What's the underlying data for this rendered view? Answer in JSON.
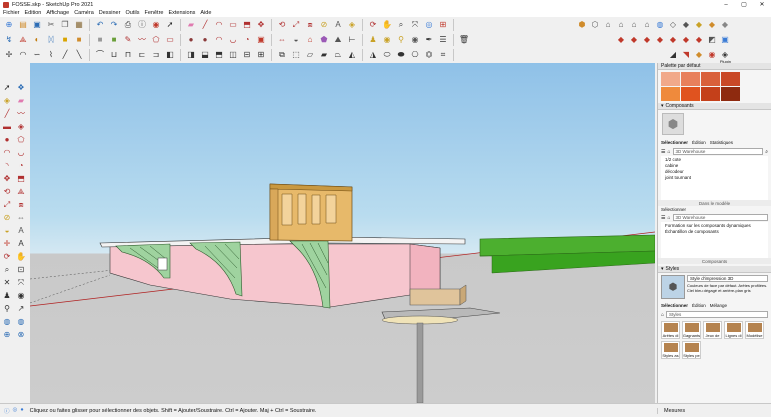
{
  "window": {
    "title": "FOSSE.skp - SketchUp Pro 2021"
  },
  "menu": [
    "Fichier",
    "Edition",
    "Affichage",
    "Caméra",
    "Dessiner",
    "Outils",
    "Fenêtre",
    "Extensions",
    "Aide"
  ],
  "toolbar1": [
    {
      "icon": "new-file-icon",
      "glyph": "⊕",
      "color": "#3a7bd5"
    },
    {
      "icon": "open-icon",
      "glyph": "▤",
      "color": "#d08c2c"
    },
    {
      "icon": "save-icon",
      "glyph": "▣",
      "color": "#2d6db5"
    },
    {
      "icon": "cut-icon",
      "glyph": "✂",
      "color": "#555"
    },
    {
      "icon": "copy-icon",
      "glyph": "❐",
      "color": "#555"
    },
    {
      "icon": "paste-icon",
      "glyph": "▦",
      "color": "#8a6d3b"
    },
    {
      "icon": "undo-icon",
      "glyph": "↶",
      "color": "#2d6db5"
    },
    {
      "icon": "redo-icon",
      "glyph": "↷",
      "color": "#2d6db5"
    },
    {
      "icon": "print-icon",
      "glyph": "⎙",
      "color": "#444"
    },
    {
      "icon": "model-info-icon",
      "glyph": "ⓘ",
      "color": "#555"
    },
    {
      "icon": "warehouse-icon",
      "glyph": "◉",
      "color": "#c0392b"
    },
    {
      "icon": "select-icon",
      "glyph": "➚",
      "color": "#222"
    },
    {
      "icon": "eraser-icon",
      "glyph": "▰",
      "color": "#e07bb0"
    },
    {
      "icon": "line-icon",
      "glyph": "╱",
      "color": "#b03030"
    },
    {
      "icon": "arc-icon",
      "glyph": "◠",
      "color": "#b03030"
    },
    {
      "icon": "shape-icon",
      "glyph": "▭",
      "color": "#b03030"
    },
    {
      "icon": "push-pull-icon",
      "glyph": "⬒",
      "color": "#b03030"
    },
    {
      "icon": "move-icon",
      "glyph": "✥",
      "color": "#b03030"
    },
    {
      "icon": "rotate-icon",
      "glyph": "⟲",
      "color": "#b03030"
    },
    {
      "icon": "scale-icon",
      "glyph": "⤢",
      "color": "#b03030"
    },
    {
      "icon": "offset-icon",
      "glyph": "⧈",
      "color": "#b03030"
    },
    {
      "icon": "tape-icon",
      "glyph": "⊘",
      "color": "#c9a227"
    },
    {
      "icon": "text-icon",
      "glyph": "A",
      "color": "#555"
    },
    {
      "icon": "paint-icon",
      "glyph": "◈",
      "color": "#c9a227"
    },
    {
      "icon": "orbit-icon",
      "glyph": "⟳",
      "color": "#b03030"
    },
    {
      "icon": "pan-icon",
      "glyph": "✋",
      "color": "#b03030"
    },
    {
      "icon": "zoom-icon",
      "glyph": "⌕",
      "color": "#333"
    },
    {
      "icon": "zoom-extents-icon",
      "glyph": "⤧",
      "color": "#333"
    },
    {
      "icon": "share-model-icon",
      "glyph": "◎",
      "color": "#3a7bd5"
    },
    {
      "icon": "extension-icon",
      "glyph": "⊞",
      "color": "#c0392b"
    }
  ],
  "toolbar1_right": [
    {
      "icon": "iso-view-icon",
      "glyph": "⬢",
      "color": "#d08c2c"
    },
    {
      "icon": "top-view-icon",
      "glyph": "⬡",
      "color": "#555"
    },
    {
      "icon": "front-view-icon",
      "glyph": "⌂",
      "color": "#555"
    },
    {
      "icon": "right-view-icon",
      "glyph": "⌂",
      "color": "#555"
    },
    {
      "icon": "back-view-icon",
      "glyph": "⌂",
      "color": "#555"
    },
    {
      "icon": "left-view-icon",
      "glyph": "⌂",
      "color": "#555"
    },
    {
      "icon": "xray-icon",
      "glyph": "◍",
      "color": "#3a7bd5"
    },
    {
      "icon": "wireframe-icon",
      "glyph": "◇",
      "color": "#555"
    },
    {
      "icon": "hidden-line-icon",
      "glyph": "◆",
      "color": "#555"
    },
    {
      "icon": "shaded-icon",
      "glyph": "◆",
      "color": "#c9a227"
    },
    {
      "icon": "textured-icon",
      "glyph": "◆",
      "color": "#d08c2c"
    },
    {
      "icon": "monochrome-icon",
      "glyph": "◆",
      "color": "#888"
    }
  ],
  "toolbar2": [
    {
      "icon": "axes-icon",
      "glyph": "↯",
      "color": "#2d6db5"
    },
    {
      "icon": "follow-me-icon",
      "glyph": "⟁",
      "color": "#c0392b"
    },
    {
      "icon": "section-plane-icon",
      "glyph": "◐",
      "color": "#c27c0e"
    },
    {
      "icon": "butterfly-icon",
      "glyph": "ᛞ",
      "color": "#2d6db5"
    },
    {
      "icon": "box-yellow-icon",
      "glyph": "■",
      "color": "#d9a400"
    },
    {
      "icon": "box-orange-icon",
      "glyph": "■",
      "color": "#d08c2c"
    },
    {
      "icon": "box-grey-icon",
      "glyph": "■",
      "color": "#999"
    },
    {
      "icon": "box-green-icon",
      "glyph": "■",
      "color": "#6a9f3a"
    },
    {
      "icon": "pencil-icon",
      "glyph": "✎",
      "color": "#b03030"
    },
    {
      "icon": "freehand-icon",
      "glyph": "〰",
      "color": "#b03030"
    },
    {
      "icon": "polygon-icon",
      "glyph": "⬠",
      "color": "#b03030"
    },
    {
      "icon": "rect-icon",
      "glyph": "▭",
      "color": "#b03030"
    },
    {
      "icon": "circle-icon",
      "glyph": "●",
      "color": "#8b3a3a"
    },
    {
      "icon": "circle2-icon",
      "glyph": "●",
      "color": "#8b3a3a"
    },
    {
      "icon": "arc2-icon",
      "glyph": "◠",
      "color": "#b03030"
    },
    {
      "icon": "arc3-icon",
      "glyph": "◡",
      "color": "#b03030"
    },
    {
      "icon": "pie-icon",
      "glyph": "◔",
      "color": "#b03030"
    },
    {
      "icon": "cube-icon",
      "glyph": "▣",
      "color": "#c0392b"
    },
    {
      "icon": "dims-icon",
      "glyph": "⇔",
      "color": "#b03030"
    },
    {
      "icon": "protractor-icon",
      "glyph": "◒",
      "color": "#555"
    },
    {
      "icon": "house-icon",
      "glyph": "⌂",
      "color": "#c0392b"
    },
    {
      "icon": "solid-icon",
      "glyph": "⬟",
      "color": "#9b59b6"
    },
    {
      "icon": "sandbox-icon",
      "glyph": "⛰",
      "color": "#555"
    },
    {
      "icon": "tag-icon",
      "glyph": "⊢",
      "color": "#333"
    },
    {
      "icon": "walk-icon",
      "glyph": "♟",
      "color": "#c9a227"
    },
    {
      "icon": "lookaround-icon",
      "glyph": "◉",
      "color": "#c9a227"
    },
    {
      "icon": "position-cam-icon",
      "glyph": "⚲",
      "color": "#c9a227"
    },
    {
      "icon": "dims2-icon",
      "glyph": "◉",
      "color": "#555"
    },
    {
      "icon": "eyedrop-icon",
      "glyph": "✒",
      "color": "#333"
    },
    {
      "icon": "layers-icon",
      "glyph": "☰",
      "color": "#333"
    },
    {
      "icon": "trash-icon",
      "glyph": "🗑",
      "color": "#333"
    }
  ],
  "toolbar2_right": [
    {
      "icon": "solid-union-icon",
      "glyph": "◆",
      "color": "#c0392b"
    },
    {
      "icon": "solid-intersect-icon",
      "glyph": "◆",
      "color": "#c0392b"
    },
    {
      "icon": "solid-subtract-icon",
      "glyph": "◆",
      "color": "#c0392b"
    },
    {
      "icon": "solid-trim-icon",
      "glyph": "◆",
      "color": "#c0392b"
    },
    {
      "icon": "solid-split-icon",
      "glyph": "◆",
      "color": "#c0392b"
    },
    {
      "icon": "outer-shell-icon",
      "glyph": "◆",
      "color": "#c0392b"
    },
    {
      "icon": "solid-shell-icon",
      "glyph": "◆",
      "color": "#c0392b"
    },
    {
      "icon": "box-icon",
      "glyph": "◩",
      "color": "#555"
    },
    {
      "icon": "app-icon",
      "glyph": "▣",
      "color": "#3a7bd5"
    }
  ],
  "toolbar3": [
    {
      "icon": "move-sel-icon",
      "glyph": "✢",
      "color": "#333"
    },
    {
      "icon": "arc-t3-icon",
      "glyph": "◠",
      "color": "#333"
    },
    {
      "icon": "curve-t3-icon",
      "glyph": "∽",
      "color": "#333"
    },
    {
      "icon": "spline-t3-icon",
      "glyph": "⌇",
      "color": "#333"
    },
    {
      "icon": "t3-a-icon",
      "glyph": "╱",
      "color": "#333"
    },
    {
      "icon": "t3-b-icon",
      "glyph": "╲",
      "color": "#333"
    },
    {
      "icon": "t3-c-icon",
      "glyph": "⌒",
      "color": "#333"
    },
    {
      "icon": "t3-d-icon",
      "glyph": "⊔",
      "color": "#333"
    },
    {
      "icon": "t3-e-icon",
      "glyph": "⊓",
      "color": "#333"
    },
    {
      "icon": "t3-f-icon",
      "glyph": "⊏",
      "color": "#333"
    },
    {
      "icon": "t3-g-icon",
      "glyph": "⊐",
      "color": "#333"
    },
    {
      "icon": "t3-h-icon",
      "glyph": "◧",
      "color": "#333"
    },
    {
      "icon": "t3-i-icon",
      "glyph": "◨",
      "color": "#333"
    },
    {
      "icon": "t3-j-icon",
      "glyph": "⬓",
      "color": "#333"
    },
    {
      "icon": "t3-k-icon",
      "glyph": "⬒",
      "color": "#333"
    },
    {
      "icon": "t3-l-icon",
      "glyph": "◫",
      "color": "#333"
    },
    {
      "icon": "t3-m-icon",
      "glyph": "⊟",
      "color": "#333"
    },
    {
      "icon": "t3-n-icon",
      "glyph": "⊞",
      "color": "#333"
    },
    {
      "icon": "t3-o-icon",
      "glyph": "⧉",
      "color": "#333"
    },
    {
      "icon": "t3-p-icon",
      "glyph": "⬚",
      "color": "#333"
    },
    {
      "icon": "t3-q-icon",
      "glyph": "▱",
      "color": "#333"
    },
    {
      "icon": "t3-r-icon",
      "glyph": "▰",
      "color": "#333"
    },
    {
      "icon": "t3-s-icon",
      "glyph": "⏢",
      "color": "#333"
    },
    {
      "icon": "t3-t-icon",
      "glyph": "◭",
      "color": "#333"
    },
    {
      "icon": "t3-u-icon",
      "glyph": "◮",
      "color": "#333"
    },
    {
      "icon": "t3-v-icon",
      "glyph": "⬭",
      "color": "#333"
    },
    {
      "icon": "t3-w-icon",
      "glyph": "⬬",
      "color": "#333"
    },
    {
      "icon": "t3-x-icon",
      "glyph": "⎔",
      "color": "#333"
    },
    {
      "icon": "t3-y-icon",
      "glyph": "⏣",
      "color": "#333"
    },
    {
      "icon": "t3-z-icon",
      "glyph": "⌗",
      "color": "#333"
    }
  ],
  "toolbar3_right": [
    {
      "icon": "t3-r1-icon",
      "glyph": "◢",
      "color": "#333"
    },
    {
      "icon": "t3-r2-icon",
      "glyph": "◥",
      "color": "#c0392b"
    },
    {
      "icon": "t3-r3-icon",
      "glyph": "◆",
      "color": "#d08c2c"
    },
    {
      "icon": "t3-r4-icon",
      "glyph": "◉",
      "color": "#c0392b"
    },
    {
      "icon": "t3-r5-icon",
      "glyph": "◈",
      "color": "#333"
    }
  ],
  "plugin_label": "Plugin",
  "left_toolbar": [
    {
      "icon": "select-arrow-icon",
      "glyph": "➚",
      "color": "#222"
    },
    {
      "icon": "component-icon",
      "glyph": "❖",
      "color": "#2d6db5"
    },
    {
      "icon": "paint-bucket-icon",
      "glyph": "◈",
      "color": "#c9a227"
    },
    {
      "icon": "eraser-left-icon",
      "glyph": "▰",
      "color": "#e07bb0"
    },
    {
      "icon": "line-left-icon",
      "glyph": "╱",
      "color": "#b03030"
    },
    {
      "icon": "freehand-left-icon",
      "glyph": "〰",
      "color": "#b03030"
    },
    {
      "icon": "rect-left-icon",
      "glyph": "▬",
      "color": "#b03030"
    },
    {
      "icon": "rotated-rect-icon",
      "glyph": "◈",
      "color": "#b03030"
    },
    {
      "icon": "circle-left-icon",
      "glyph": "●",
      "color": "#b03030"
    },
    {
      "icon": "polygon-left-icon",
      "glyph": "⬠",
      "color": "#b03030"
    },
    {
      "icon": "arc-left-icon",
      "glyph": "◠",
      "color": "#b03030"
    },
    {
      "icon": "arc2-left-icon",
      "glyph": "◡",
      "color": "#b03030"
    },
    {
      "icon": "arc3-left-icon",
      "glyph": "◝",
      "color": "#b03030"
    },
    {
      "icon": "pie-left-icon",
      "glyph": "◔",
      "color": "#b03030"
    },
    {
      "icon": "move-left-icon",
      "glyph": "✥",
      "color": "#b03030"
    },
    {
      "icon": "push-left-icon",
      "glyph": "⬒",
      "color": "#b03030"
    },
    {
      "icon": "rotate-left-icon",
      "glyph": "⟲",
      "color": "#b03030"
    },
    {
      "icon": "follow-left-icon",
      "glyph": "⟁",
      "color": "#b03030"
    },
    {
      "icon": "scale-left-icon",
      "glyph": "⤢",
      "color": "#b03030"
    },
    {
      "icon": "offset-left-icon",
      "glyph": "⧈",
      "color": "#b03030"
    },
    {
      "icon": "tape-left-icon",
      "glyph": "⊘",
      "color": "#c9a227"
    },
    {
      "icon": "dimension-left-icon",
      "glyph": "⇔",
      "color": "#555"
    },
    {
      "icon": "protractor-left-icon",
      "glyph": "◒",
      "color": "#c9a227"
    },
    {
      "icon": "text-left-icon",
      "glyph": "A",
      "color": "#555"
    },
    {
      "icon": "axes-left-icon",
      "glyph": "✛",
      "color": "#c0392b"
    },
    {
      "icon": "3dtext-left-icon",
      "glyph": "A",
      "color": "#333"
    },
    {
      "icon": "orbit-left-icon",
      "glyph": "⟳",
      "color": "#b03030"
    },
    {
      "icon": "pan-left-icon",
      "glyph": "✋",
      "color": "#b03030"
    },
    {
      "icon": "zoom-left-icon",
      "glyph": "⌕",
      "color": "#333"
    },
    {
      "icon": "zoom-window-icon",
      "glyph": "⊡",
      "color": "#333"
    },
    {
      "icon": "zoom-extents-left-icon",
      "glyph": "✕",
      "color": "#333"
    },
    {
      "icon": "prev-view-icon",
      "glyph": "⤧",
      "color": "#333"
    },
    {
      "icon": "position-camera-icon",
      "glyph": "♟",
      "color": "#333"
    },
    {
      "icon": "look-around-icon",
      "glyph": "◉",
      "color": "#333"
    },
    {
      "icon": "walk-left-icon",
      "glyph": "⚲",
      "color": "#333"
    },
    {
      "icon": "section-left-icon",
      "glyph": "↗",
      "color": "#333"
    },
    {
      "icon": "display-sections-icon",
      "glyph": "◍",
      "color": "#2d6db5"
    },
    {
      "icon": "section-cut-icon",
      "glyph": "◍",
      "color": "#2d6db5"
    },
    {
      "icon": "section-fill-icon",
      "glyph": "⊕",
      "color": "#2d6db5"
    },
    {
      "icon": "misc-left-icon",
      "glyph": "⊗",
      "color": "#2d6db5"
    }
  ],
  "tray": {
    "palette_title": "Palette par défaut",
    "palette_colors": [
      "#f1a98a",
      "#e8805c",
      "#d9603a",
      "#c94826",
      "#ef8a3c",
      "#e0531f",
      "#c4401a",
      "#8e2a0f"
    ],
    "components_title": "Composants",
    "components_tabs": [
      "Sélectionner",
      "Édition",
      "Statistiques"
    ],
    "components_search": "3D Warehouse",
    "components_list": [
      "1/2 cote",
      "cabine",
      "décodeur",
      "joint tournant"
    ],
    "in_model_label": "Dans le modèle",
    "select_title": "Sélectionner",
    "select_search": "3D Warehouse",
    "select_list": [
      "Formation sur les composants dynamiques",
      "Échantillon de composants"
    ],
    "components_footer": "Composants",
    "styles_title": "Styles",
    "style_name": "Style d'impression 3D",
    "style_desc": "Couleurs de face par défaut. Arêtes profilées. Ciel bleu dégagé et arrière-plan gris",
    "styles_tabs": [
      "Sélectionner",
      "Édition",
      "Mélange"
    ],
    "styles_dropdown": "Styles",
    "style_items": [
      "Arêtes di",
      "Gagnants",
      "Jeux de",
      "Lignes di",
      "Modélise",
      "Styles as",
      "Styles pe"
    ]
  },
  "status": {
    "message": "Cliquez ou faites glisser pour sélectionner des objets. Shift = Ajouter/Soustraire. Ctrl = Ajouter. Maj + Ctrl = Soustraire.",
    "measures_label": "Mesures"
  }
}
